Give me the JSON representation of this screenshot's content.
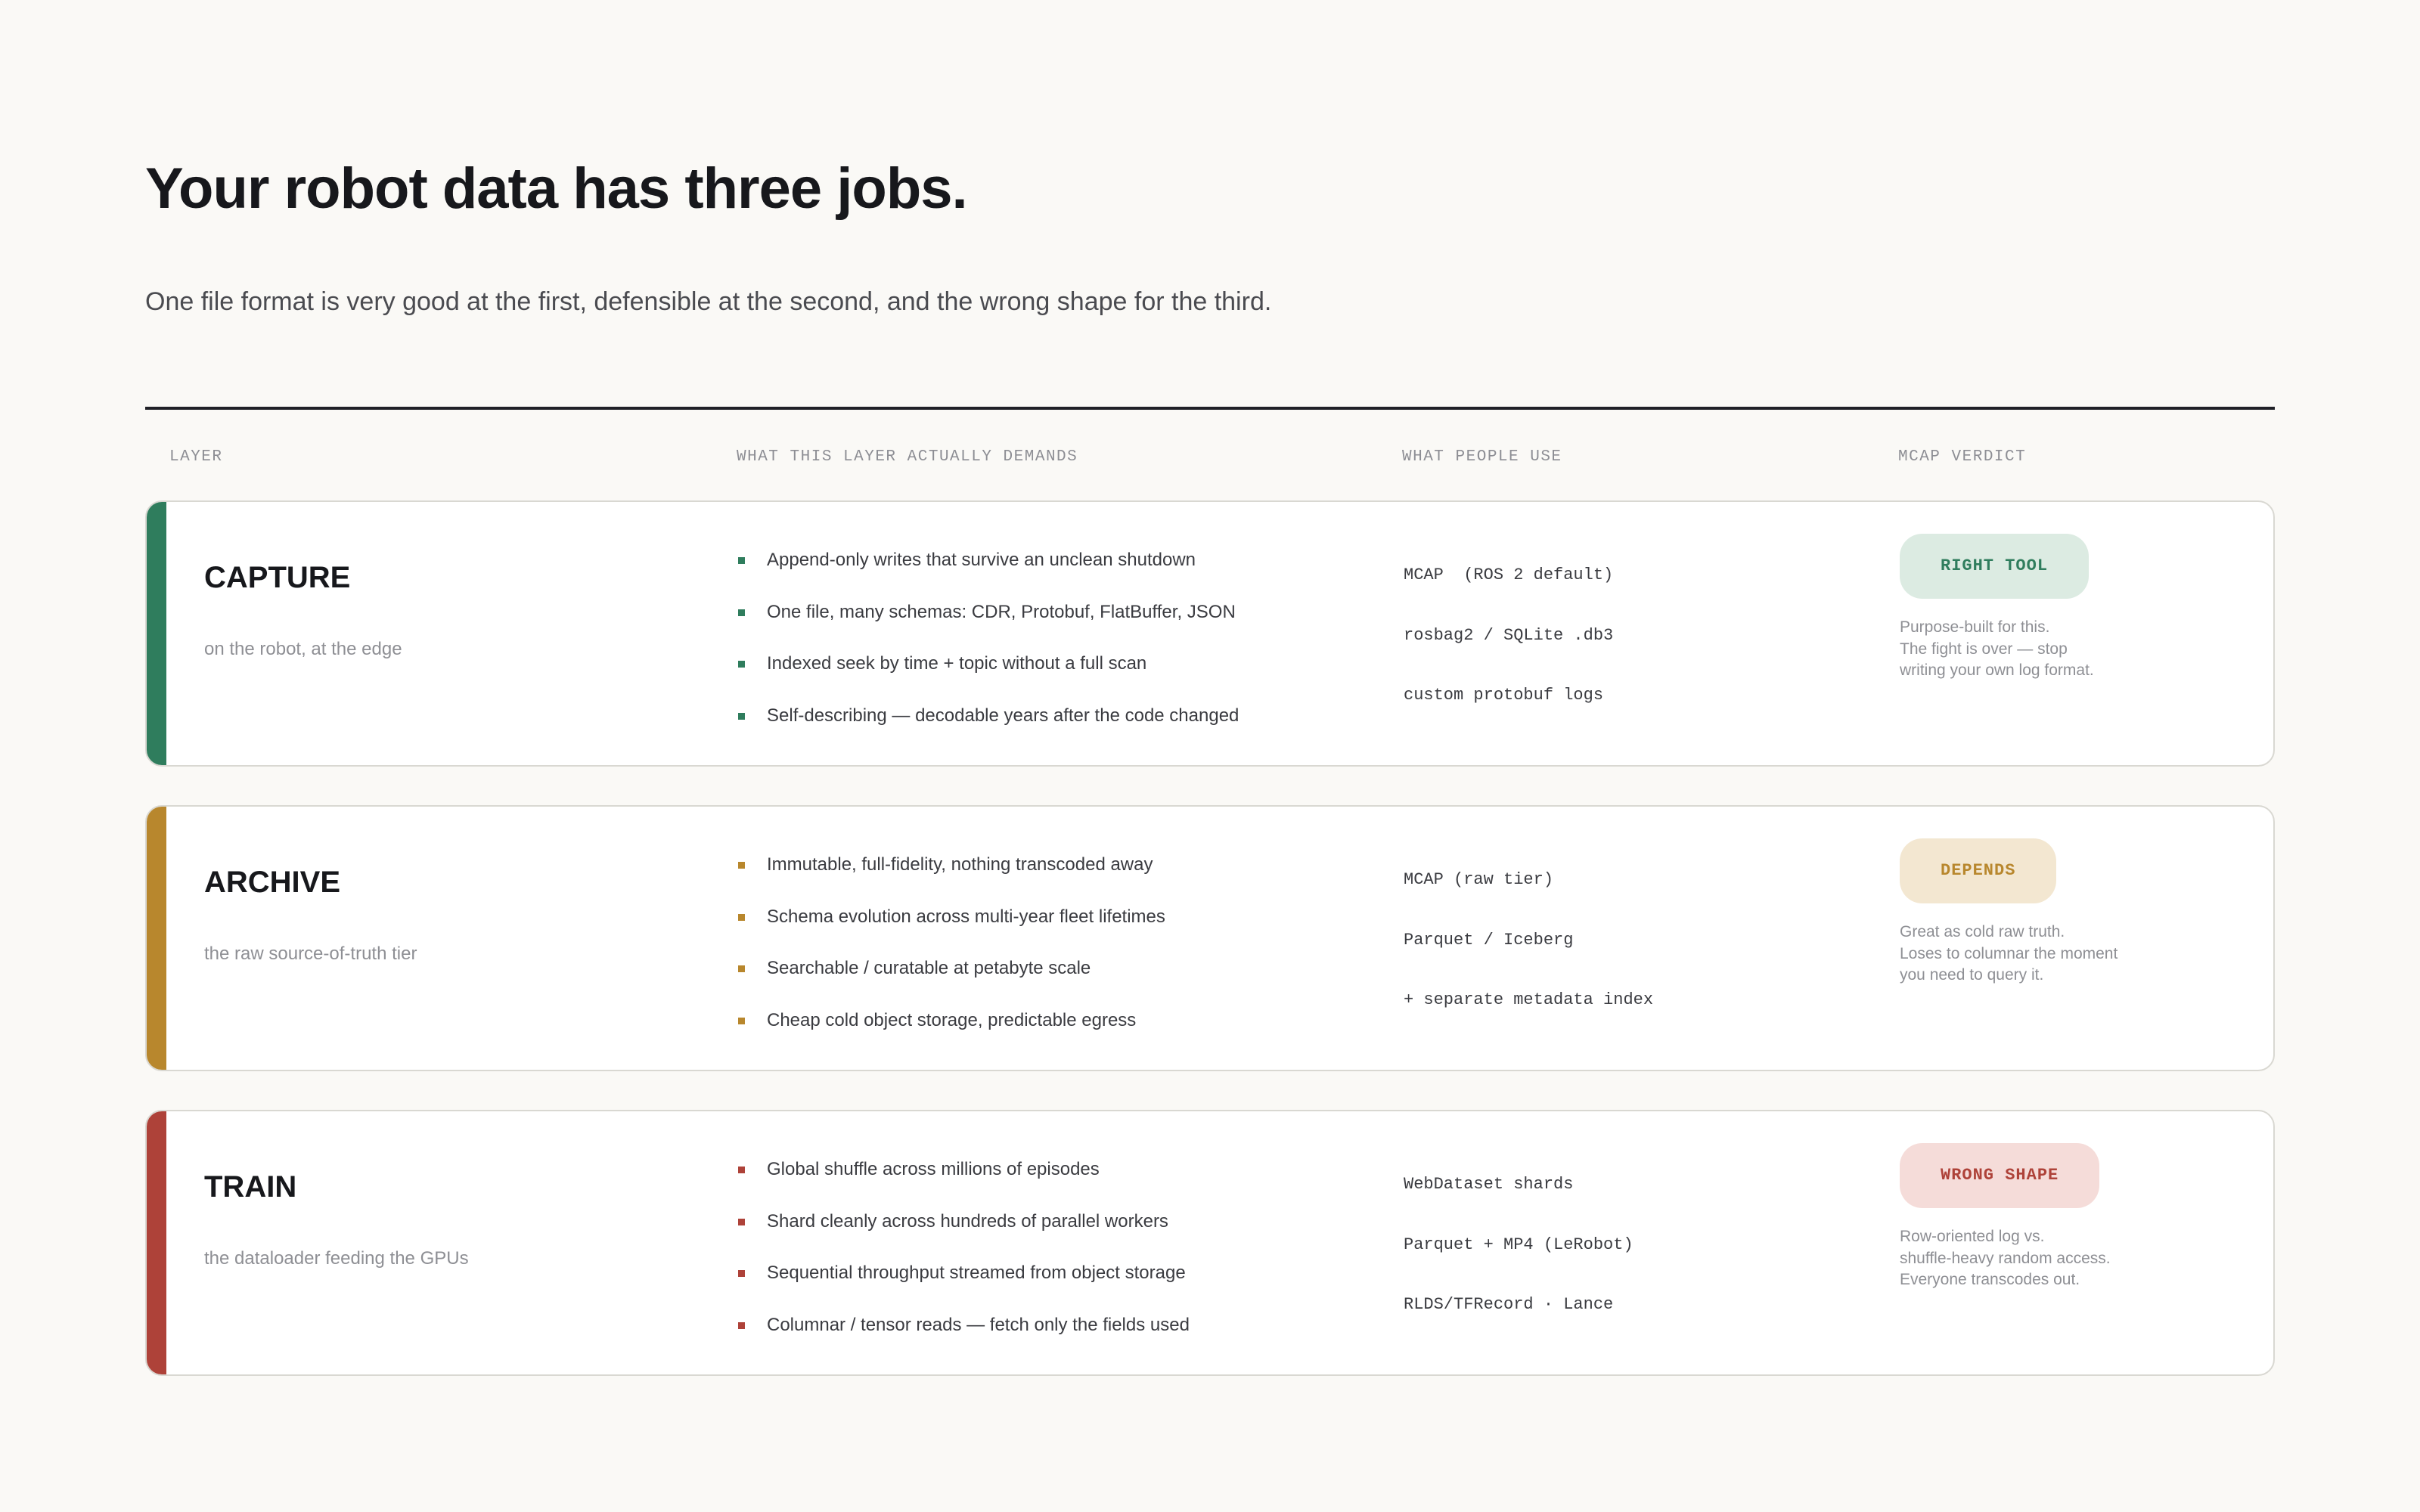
{
  "header": {
    "title": "Your robot data has three jobs.",
    "subtitle": "One file format is very good at the first, defensible at the second, and the wrong shape for the third."
  },
  "columns": {
    "layer": "LAYER",
    "demands": "WHAT THIS LAYER ACTUALLY DEMANDS",
    "uses": "WHAT PEOPLE USE",
    "verdict": "MCAP VERDICT"
  },
  "colors": {
    "capture": "#2f7d5d",
    "archive": "#b8872d",
    "train": "#ae4239",
    "capture_badge_bg": "#dcebe2",
    "archive_badge_bg": "#f3e7d1",
    "train_badge_bg": "#f5dcd9"
  },
  "rows": [
    {
      "name": "CAPTURE",
      "description": "on the robot, at the edge",
      "demands": [
        "Append-only writes that survive an unclean shutdown",
        "One file, many schemas: CDR, Protobuf, FlatBuffer, JSON",
        "Indexed seek by time + topic without a full scan",
        "Self-describing — decodable years after the code changed"
      ],
      "uses": [
        "MCAP  (ROS 2 default)",
        "rosbag2 / SQLite .db3",
        "custom protobuf logs"
      ],
      "verdict": "RIGHT TOOL",
      "verdict_note": [
        "Purpose-built for this.",
        "The fight is over — stop",
        "writing your own log format."
      ]
    },
    {
      "name": "ARCHIVE",
      "description": "the raw source-of-truth tier",
      "demands": [
        "Immutable, full-fidelity, nothing transcoded away",
        "Schema evolution across multi-year fleet lifetimes",
        "Searchable / curatable at petabyte scale",
        "Cheap cold object storage, predictable egress"
      ],
      "uses": [
        "MCAP (raw tier)",
        "Parquet / Iceberg",
        "+ separate metadata index"
      ],
      "verdict": "DEPENDS",
      "verdict_note": [
        "Great as cold raw truth.",
        "Loses to columnar the moment",
        "you need to query it."
      ]
    },
    {
      "name": "TRAIN",
      "description": "the dataloader feeding the GPUs",
      "demands": [
        "Global shuffle across millions of episodes",
        "Shard cleanly across hundreds of parallel workers",
        "Sequential throughput streamed from object storage",
        "Columnar / tensor reads — fetch only the fields used"
      ],
      "uses": [
        "WebDataset shards",
        "Parquet + MP4 (LeRobot)",
        "RLDS/TFRecord · Lance"
      ],
      "verdict": "WRONG SHAPE",
      "verdict_note": [
        "Row-oriented log vs.",
        "shuffle-heavy random access.",
        "Everyone transcodes out."
      ]
    }
  ]
}
